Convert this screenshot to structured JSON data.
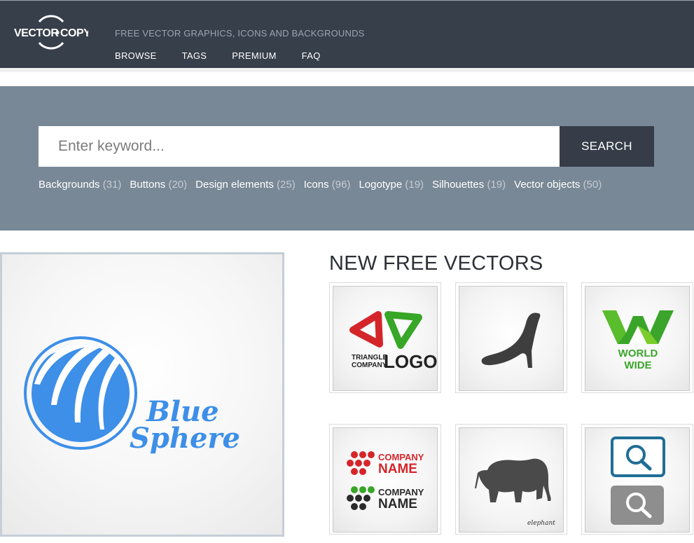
{
  "header": {
    "logo_text_left": "VECTOR",
    "logo_text_right": "COPY",
    "tagline": "FREE VECTOR GRAPHICS, ICONS AND BACKGROUNDS",
    "nav": [
      "BROWSE",
      "TAGS",
      "PREMIUM",
      "FAQ"
    ]
  },
  "search": {
    "placeholder": "Enter keyword...",
    "button_label": "SEARCH"
  },
  "categories": [
    {
      "label": "Backgrounds",
      "count": "(31)"
    },
    {
      "label": "Buttons",
      "count": "(20)"
    },
    {
      "label": "Design elements",
      "count": "(25)"
    },
    {
      "label": "Icons",
      "count": "(96)"
    },
    {
      "label": "Logotype",
      "count": "(19)"
    },
    {
      "label": "Silhouettes",
      "count": "(19)"
    },
    {
      "label": "Vector objects",
      "count": "(50)"
    }
  ],
  "featured": {
    "line1": "Blue",
    "line2": "Sphere"
  },
  "new_vectors": {
    "title": "NEW FREE VECTORS",
    "items": [
      {
        "icon": "triangle-logo-icon",
        "line1": "TRIANGLE",
        "line2": "COMPANY",
        "line3": "LOGO"
      },
      {
        "icon": "high-heel-shoe-icon"
      },
      {
        "icon": "world-wide-logo-icon",
        "line1": "WORLD",
        "line2": "WIDE"
      },
      {
        "icon": "company-name-logos-icon",
        "line1": "COMPANY",
        "line2": "NAME",
        "line3": "COMPANY",
        "line4": "NAME"
      },
      {
        "icon": "elephant-icon",
        "caption": "elephant"
      },
      {
        "icon": "search-buttons-icon"
      }
    ]
  },
  "colors": {
    "header_bg": "#373f4b",
    "search_band": "#798896",
    "search_button": "#363d49",
    "featured_blue": "#3d8fe8",
    "red": "#d4262a",
    "green": "#38a626"
  }
}
